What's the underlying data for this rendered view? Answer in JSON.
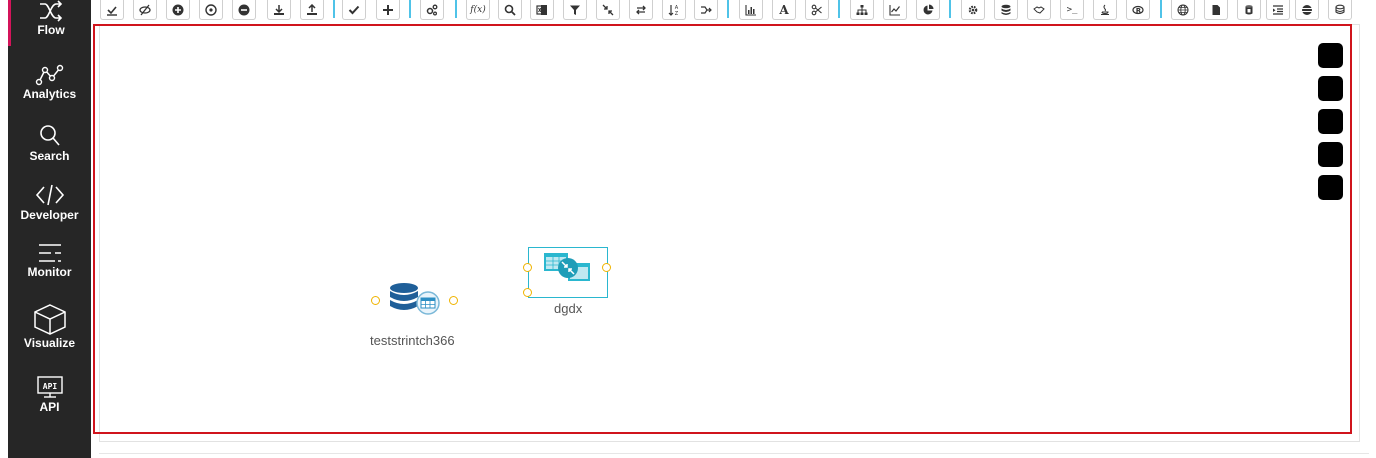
{
  "sidebar": {
    "items": [
      {
        "label": "Flow",
        "icon": "flow-shuffle-icon",
        "active": true
      },
      {
        "label": "Analytics",
        "icon": "analytics-network-icon"
      },
      {
        "label": "Search",
        "icon": "search-icon"
      },
      {
        "label": "Developer",
        "icon": "code-icon"
      },
      {
        "label": "Monitor",
        "icon": "monitor-lines-icon"
      },
      {
        "label": "Visualize",
        "icon": "cube-icon"
      },
      {
        "label": "API",
        "icon": "api-icon",
        "icon_text": "API"
      }
    ]
  },
  "toolbar": {
    "buttons": [
      {
        "icon": "select-all-icon"
      },
      {
        "icon": "eye-slash-icon"
      },
      {
        "icon": "plus-circle-icon"
      },
      {
        "icon": "dot-circle-icon"
      },
      {
        "icon": "minus-circle-icon"
      },
      {
        "icon": "download-icon"
      },
      {
        "icon": "upload-icon"
      },
      {
        "icon": "check-icon"
      },
      {
        "icon": "plus-icon"
      },
      {
        "icon": "cogs-icon"
      },
      {
        "icon": "function-icon",
        "text": "f(x)"
      },
      {
        "icon": "search-icon"
      },
      {
        "icon": "excel-icon"
      },
      {
        "icon": "filter-icon"
      },
      {
        "icon": "compress-icon"
      },
      {
        "icon": "exchange-icon"
      },
      {
        "icon": "sort-alpha-icon"
      },
      {
        "icon": "join-icon"
      },
      {
        "icon": "bar-chart-icon"
      },
      {
        "icon": "font-icon",
        "text": "A"
      },
      {
        "icon": "scissors-icon"
      },
      {
        "icon": "sitemap-icon"
      },
      {
        "icon": "line-chart-icon"
      },
      {
        "icon": "pie-chart-icon"
      },
      {
        "icon": "gear-icon"
      },
      {
        "icon": "database-icon"
      },
      {
        "icon": "handshake-icon"
      },
      {
        "icon": "terminal-icon",
        "text": ">_"
      },
      {
        "icon": "java-icon"
      },
      {
        "icon": "r-language-icon"
      },
      {
        "icon": "globe-icon"
      },
      {
        "icon": "file-icon"
      },
      {
        "icon": "cylinder-icon"
      },
      {
        "icon": "indent-icon"
      },
      {
        "icon": "database-stack-icon"
      },
      {
        "icon": "database-export-icon"
      }
    ]
  },
  "canvas": {
    "nodes": [
      {
        "label": "teststrintch366",
        "icon": "database-table-icon",
        "type": "source"
      },
      {
        "label": "dgdx",
        "icon": "compress-tables-icon",
        "type": "transform",
        "selected": true
      }
    ]
  },
  "colors": {
    "sidebar_bg": "#262626",
    "active_accent": "#d4145a",
    "canvas_border": "#d0141c",
    "toolbar_separator": "#4fc3e8",
    "port": "#f0b400",
    "node_db": "#1f5f99",
    "node_transform": "#2ab7cf"
  }
}
